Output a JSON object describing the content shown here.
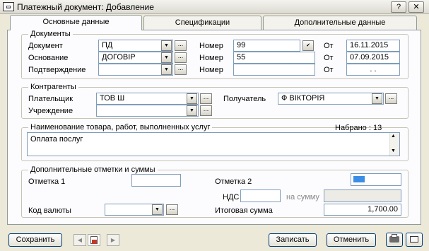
{
  "window": {
    "title": "Платежный документ: Добавление",
    "help": "?",
    "close": "✕"
  },
  "tabs": [
    {
      "label": "Основные данные"
    },
    {
      "label": "Спецификации"
    },
    {
      "label": "Дополнительные данные"
    }
  ],
  "documents": {
    "title": "Документы",
    "rows": [
      {
        "label": "Документ",
        "value": "ПД",
        "number_label": "Номер",
        "number": "99",
        "date_label": "От",
        "date": "16.11.2015"
      },
      {
        "label": "Основание",
        "value": "ДОГОВІР",
        "number_label": "Номер",
        "number": "55",
        "date_label": "От",
        "date": "07.09.2015"
      },
      {
        "label": "Подтверждение",
        "value": "",
        "number_label": "Номер",
        "number": "",
        "date_label": "От",
        "date": " .  ."
      }
    ]
  },
  "counterparties": {
    "title": "Контрагенты",
    "payer_label": "Плательщик",
    "payer": "ТОВ Ш",
    "recipient_label": "Получатель",
    "recipient": "Ф ВІКТОРІЯ",
    "institution_label": "Учреждение",
    "institution": ""
  },
  "goods": {
    "title": "Наименование товара, работ, выполненных услуг",
    "counter": "Набрано : 13",
    "text": "Оплата послуг"
  },
  "extra": {
    "title": "Дополнительные отметки и суммы",
    "mark1_label": "Отметка 1",
    "mark1": "",
    "mark2_label": "Отметка 2",
    "vat_label": "НДС",
    "vat": "",
    "on_sum_label": "на сумму",
    "on_sum": "",
    "currency_label": "Код валюты",
    "currency": "",
    "total_label": "Итоговая сумма",
    "total": "1,700.00"
  },
  "footer": {
    "save": "Сохранить",
    "record": "Записать",
    "cancel": "Отменить"
  }
}
